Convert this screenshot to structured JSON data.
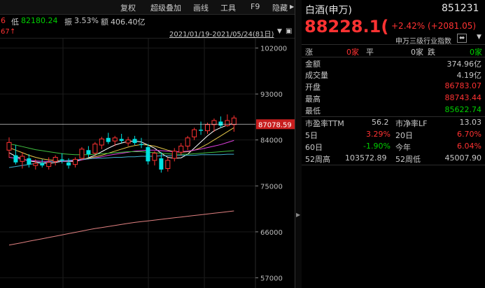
{
  "toolbar": {
    "restore": "复权",
    "overlay": "超级叠加",
    "drawline": "画线",
    "tools": "工具",
    "f9": "F9",
    "hide": "隐藏"
  },
  "stats": {
    "left_cut": "6",
    "low_label": "低",
    "low_value": "82180.24",
    "amp_label": "振",
    "amp_value": "3.53%",
    "amount_label": "额",
    "amount_value": "406.40亿"
  },
  "range": {
    "left_cut": "67",
    "left_icon": "↑",
    "dates": "2021/01/19-2021/05/24(81日)"
  },
  "chart_data": {
    "type": "candlestick",
    "title": "",
    "y_ticks": [
      102000,
      93000,
      84000,
      75000,
      66000,
      57000
    ],
    "ylim": [
      55000,
      104000
    ],
    "current_price_label": "87078.59",
    "candles": [
      {
        "o": 82000,
        "h": 84500,
        "l": 80500,
        "c": 83500
      },
      {
        "o": 81000,
        "h": 83000,
        "l": 79200,
        "c": 79600
      },
      {
        "o": 79800,
        "h": 81600,
        "l": 78400,
        "c": 80800
      },
      {
        "o": 80400,
        "h": 81200,
        "l": 78600,
        "c": 79200
      },
      {
        "o": 79000,
        "h": 80200,
        "l": 78200,
        "c": 79400
      },
      {
        "o": 79400,
        "h": 80200,
        "l": 78600,
        "c": 79000
      },
      {
        "o": 78800,
        "h": 80600,
        "l": 78200,
        "c": 79600
      },
      {
        "o": 79800,
        "h": 81000,
        "l": 79000,
        "c": 80600
      },
      {
        "o": 80200,
        "h": 81400,
        "l": 79400,
        "c": 80000
      },
      {
        "o": 79600,
        "h": 80400,
        "l": 78400,
        "c": 79000
      },
      {
        "o": 79200,
        "h": 80600,
        "l": 78600,
        "c": 80200
      },
      {
        "o": 80400,
        "h": 82600,
        "l": 80000,
        "c": 82200
      },
      {
        "o": 82000,
        "h": 82800,
        "l": 80600,
        "c": 81200
      },
      {
        "o": 81400,
        "h": 83600,
        "l": 81000,
        "c": 83200
      },
      {
        "o": 83000,
        "h": 84600,
        "l": 82200,
        "c": 84200
      },
      {
        "o": 84400,
        "h": 85400,
        "l": 83200,
        "c": 83600
      },
      {
        "o": 83800,
        "h": 84800,
        "l": 82800,
        "c": 84400
      },
      {
        "o": 84200,
        "h": 85200,
        "l": 83400,
        "c": 83800
      },
      {
        "o": 83400,
        "h": 84600,
        "l": 82800,
        "c": 84000
      },
      {
        "o": 84200,
        "h": 84800,
        "l": 83000,
        "c": 83400
      },
      {
        "o": 83200,
        "h": 84400,
        "l": 82400,
        "c": 83000
      },
      {
        "o": 82600,
        "h": 83200,
        "l": 79200,
        "c": 79800
      },
      {
        "o": 80000,
        "h": 81800,
        "l": 79000,
        "c": 81400
      },
      {
        "o": 80400,
        "h": 81600,
        "l": 77600,
        "c": 78200
      },
      {
        "o": 78400,
        "h": 80600,
        "l": 77800,
        "c": 80000
      },
      {
        "o": 80400,
        "h": 82400,
        "l": 79800,
        "c": 81800
      },
      {
        "o": 81600,
        "h": 83400,
        "l": 81000,
        "c": 82800
      },
      {
        "o": 82800,
        "h": 84800,
        "l": 82000,
        "c": 84400
      },
      {
        "o": 84600,
        "h": 86400,
        "l": 84000,
        "c": 86000
      },
      {
        "o": 86000,
        "h": 87600,
        "l": 85000,
        "c": 85800
      },
      {
        "o": 85800,
        "h": 87400,
        "l": 85200,
        "c": 87000
      },
      {
        "o": 87000,
        "h": 88200,
        "l": 85600,
        "c": 87800
      },
      {
        "o": 87600,
        "h": 88600,
        "l": 86400,
        "c": 86800
      },
      {
        "o": 86800,
        "h": 89000,
        "l": 86600,
        "c": 87800
      },
      {
        "o": 87000,
        "h": 88800,
        "l": 85600,
        "c": 88300
      }
    ],
    "ma_lines": [
      {
        "name": "ma5",
        "color": "#ffffff",
        "values": [
          81500,
          80800,
          80300,
          79900,
          79700,
          79500,
          79400,
          79600,
          79800,
          79800,
          79800,
          80100,
          80500,
          81000,
          81700,
          82400,
          83000,
          83400,
          83700,
          83800,
          83600,
          83000,
          82400,
          81400,
          80600,
          80400,
          80500,
          81200,
          82400,
          83600,
          84800,
          85800,
          86400,
          86900,
          87300
        ]
      },
      {
        "name": "ma10",
        "color": "#e6c84a",
        "values": [
          82500,
          82000,
          81500,
          81000,
          80600,
          80300,
          80100,
          80000,
          79900,
          79900,
          80000,
          80200,
          80400,
          80700,
          81000,
          81400,
          81800,
          82200,
          82600,
          82900,
          83100,
          83000,
          82800,
          82400,
          82000,
          81700,
          81600,
          81700,
          82000,
          82500,
          83200,
          84000,
          84800,
          85600,
          86400
        ]
      },
      {
        "name": "ma20",
        "color": "#e040e0",
        "values": [
          80600,
          80400,
          80200,
          80000,
          79900,
          79800,
          79800,
          79800,
          79800,
          79900,
          80000,
          80100,
          80300,
          80500,
          80700,
          81000,
          81200,
          81400,
          81600,
          81800,
          81900,
          82000,
          82000,
          81900,
          81800,
          81700,
          81700,
          81800,
          82000,
          82200,
          82500,
          82800,
          83100,
          83500,
          83900
        ]
      },
      {
        "name": "ma30",
        "color": "#40c040",
        "values": [
          83200,
          83000,
          82700,
          82400,
          82100,
          81900,
          81700,
          81500,
          81300,
          81200,
          81100,
          81100,
          81100,
          81200,
          81300,
          81400,
          81500,
          81600,
          81700,
          81700,
          81700,
          81600,
          81500,
          81400,
          81300,
          81200,
          81200,
          81200,
          81300,
          81400,
          81500,
          81600,
          81700,
          81800,
          81900
        ]
      },
      {
        "name": "ma60",
        "color": "#40b0d0",
        "values": [
          78600,
          78800,
          79000,
          79200,
          79400,
          79500,
          79700,
          79800,
          79900,
          80000,
          80100,
          80200,
          80300,
          80400,
          80400,
          80500,
          80600,
          80600,
          80700,
          80700,
          80800,
          80800,
          80800,
          80900,
          80900,
          80900,
          81000,
          81000,
          81000,
          81100,
          81100,
          81100,
          81100,
          81200,
          81200
        ]
      },
      {
        "name": "ma250",
        "color": "#e08080",
        "values": [
          63400,
          63650,
          63900,
          64150,
          64400,
          64650,
          64900,
          65150,
          65400,
          65650,
          65900,
          66150,
          66400,
          66650,
          66850,
          67050,
          67250,
          67450,
          67650,
          67850,
          68000,
          68150,
          68300,
          68450,
          68600,
          68750,
          68900,
          69050,
          69200,
          69350,
          69500,
          69650,
          69800,
          69950,
          70100
        ]
      }
    ]
  },
  "panel": {
    "name": "白酒(申万)",
    "code": "851231",
    "price": "88228.1(",
    "change_pct": "+2.42%",
    "change_abs": "(+2081.05)",
    "index_type": "申万三级行业指数",
    "rise_label": "涨",
    "rise_value": "0家",
    "flat_label": "平",
    "flat_value": "0家",
    "fall_label": "跌",
    "fall_value": "0家",
    "amount_label": "金额",
    "amount_value": "374.96亿",
    "volume_label": "成交量",
    "volume_value": "4.19亿",
    "open_label": "开盘",
    "open_value": "86783.07",
    "high_label": "最高",
    "high_value": "88743.44",
    "low_label": "最低",
    "low_value": "85622.74",
    "pe_label": "市盈率TTM",
    "pe_value": "56.2",
    "pb_label": "市净率LF",
    "pb_value": "13.03",
    "d5_label": "5日",
    "d5_value": "3.29%",
    "d20_label": "20日",
    "d20_value": "6.70%",
    "d60_label": "60日",
    "d60_value": "-1.90%",
    "ytd_label": "今年",
    "ytd_value": "6.04%",
    "w52h_label": "52周高",
    "w52h_value": "103572.89",
    "w52l_label": "52周低",
    "w52l_value": "45007.90"
  },
  "colors": {
    "up": "#ff3232",
    "down": "#00e0e0",
    "green": "#00d000",
    "neutral": "#c8c8c8"
  }
}
